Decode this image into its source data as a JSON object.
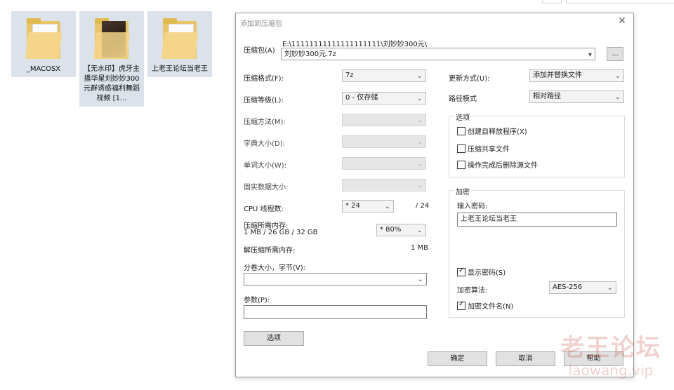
{
  "desktop": {
    "icons": [
      {
        "label": "_MACOSX",
        "type": "folder"
      },
      {
        "label": "【无水印】虎牙主播华星刘妙妙300元群诱惑福利舞蹈视频 [1...",
        "type": "folder-photo"
      },
      {
        "label": "上老王论坛当老王",
        "type": "folder"
      }
    ]
  },
  "dialog": {
    "title": "添加到压缩包",
    "close_icon": "close-icon",
    "archive": {
      "label": "压缩包(A)",
      "path": "E:\\11111111111111111111\\刘妙妙300元\\",
      "value": "刘妙妙300元.7z",
      "browse_label": "..."
    },
    "left": {
      "format": {
        "label": "压缩格式(F):",
        "value": "7z"
      },
      "level": {
        "label": "压缩等级(L):",
        "value": "0 - 仅存储"
      },
      "method": {
        "label": "压缩方法(M):",
        "value": ""
      },
      "dict": {
        "label": "字典大小(D):",
        "value": ""
      },
      "word": {
        "label": "单词大小(W):",
        "value": ""
      },
      "solid": {
        "label": "固实数据大小:",
        "value": ""
      },
      "cpu": {
        "label": "CPU 线程数:",
        "value": "* 24",
        "total": "/ 24"
      },
      "mem": {
        "label": "压缩所需内存:",
        "detail": "1 MB / 26 GB / 32 GB",
        "value": "* 80%"
      },
      "decomp": {
        "label": "解压缩所需内存:",
        "value": "1 MB"
      },
      "volume": {
        "label": "分卷大小，字节(V):",
        "value": ""
      },
      "params": {
        "label": "参数(P):",
        "value": ""
      },
      "options_button": "选项"
    },
    "right": {
      "update": {
        "label": "更新方式(U):",
        "value": "添加并替换文件"
      },
      "path_mode": {
        "label": "路径模式",
        "value": "相对路径"
      },
      "options_group": {
        "title": "选项",
        "items": [
          {
            "label": "创建自释放程序(X)",
            "checked": false
          },
          {
            "label": "压缩共享文件",
            "checked": false
          },
          {
            "label": "操作完成后删除源文件",
            "checked": false
          }
        ]
      },
      "encryption_group": {
        "title": "加密",
        "password_label": "输入密码:",
        "password_value": "上老王论坛当老王",
        "show_password": {
          "label": "显示密码(S)",
          "checked": true
        },
        "method_label": "加密算法:",
        "method_value": "AES-256",
        "encrypt_names": {
          "label": "加密文件名(N)",
          "checked": true
        }
      }
    },
    "buttons": {
      "ok": "确定",
      "cancel": "取消",
      "help": "帮助"
    }
  },
  "watermark": {
    "line1": "老王论坛",
    "line2": "laowang.vip"
  },
  "colors": {
    "folder": "#e9c46a",
    "selection": "#dbe2ea",
    "dialog_border": "#9a9a9a"
  }
}
